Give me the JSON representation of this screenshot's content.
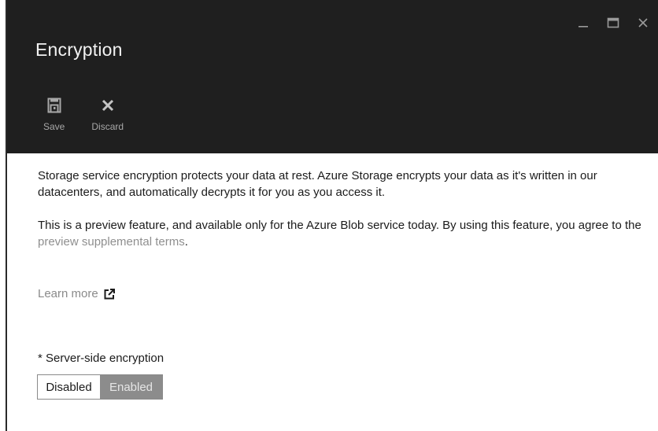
{
  "blade": {
    "title": "Encryption",
    "window_controls": [
      "minimize-icon",
      "maximize-icon",
      "close-icon"
    ]
  },
  "toolbar": {
    "save_label": "Save",
    "save_icon": "save-icon",
    "discard_label": "Discard",
    "discard_icon": "close-icon"
  },
  "content": {
    "description": "Storage service encryption protects your data at rest. Azure Storage encrypts your data as it's written in our datacenters, and automatically decrypts it for you as you access it.",
    "preview_text": "This is a preview feature, and available only for the Azure Blob service today. By using this feature, you agree to the ",
    "preview_link": "preview supplemental terms",
    "preview_end": ".",
    "learn_more": "Learn more",
    "learn_more_icon": "external-link-icon"
  },
  "setting": {
    "label": "* Server-side encryption",
    "options": [
      "Disabled",
      "Enabled"
    ],
    "selected": "Enabled"
  },
  "colors": {
    "header_bg": "#1f1f1f",
    "selected_bg": "#8c8c8c",
    "link": "#8f8f8f"
  }
}
